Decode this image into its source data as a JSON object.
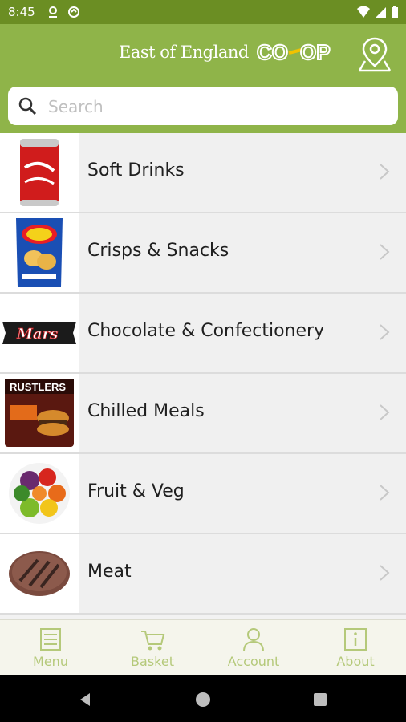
{
  "status_bar": {
    "time": "8:45"
  },
  "header": {
    "brand_text": "East of England",
    "brand_logo": "CO-OP"
  },
  "search": {
    "placeholder": "Search"
  },
  "categories": [
    {
      "label": "Soft Drinks",
      "icon": "cola-can-image"
    },
    {
      "label": "Crisps & Snacks",
      "icon": "crisps-packet-image"
    },
    {
      "label": "Chocolate & Confectionery",
      "icon": "chocolate-bar-image"
    },
    {
      "label": "Chilled Meals",
      "icon": "burger-box-image"
    },
    {
      "label": "Fruit & Veg",
      "icon": "fruit-veg-image"
    },
    {
      "label": "Meat",
      "icon": "steak-image"
    }
  ],
  "bottom_nav": [
    {
      "label": "Menu",
      "icon": "menu-icon"
    },
    {
      "label": "Basket",
      "icon": "basket-icon"
    },
    {
      "label": "Account",
      "icon": "account-icon"
    },
    {
      "label": "About",
      "icon": "about-icon"
    }
  ],
  "colors": {
    "header": "#8fb449",
    "status_bar": "#6b8e23",
    "nav_text": "#b5c97a"
  }
}
